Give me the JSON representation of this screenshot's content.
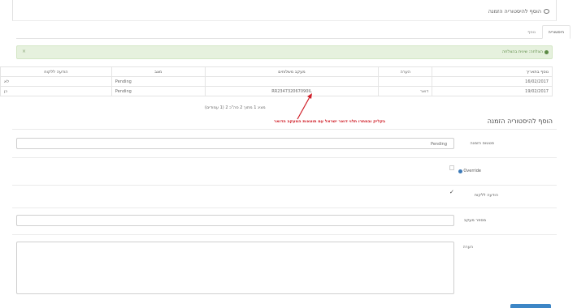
{
  "panel": {
    "title": "הוסף להיסטוריה הזמנה",
    "icon": "comment-icon"
  },
  "tabs": [
    {
      "label": "היסטוריה",
      "active": true
    },
    {
      "label": "נוסף",
      "active": false
    }
  ],
  "alert": {
    "text": "הצלחה: שינית בהצלחה",
    "close": "×",
    "color": "#e6f1de"
  },
  "history_table": {
    "headers": [
      "נוסף בתאריך",
      "הערה",
      "מעקב משלוחים",
      "מצב",
      "הודעה ללקוח"
    ],
    "rows": [
      {
        "date": "16/02/2017",
        "note": "",
        "tracking": "",
        "status": "Pending",
        "notify": "לא"
      },
      {
        "date": "19/02/2017",
        "note": "דואר",
        "tracking": "RR234732067090IL",
        "status": "Pending",
        "notify": "כן"
      }
    ]
  },
  "pagination": "מציג 1 מתוך 2 סה\"כ 2 (1 עמודים)",
  "annotation": "בקליק ובמתרו תלוי דואר ישראל עם תוצאות המעקב הדואר",
  "add_history": {
    "title": "הוסף להיסטוריה הזמנה",
    "order_status_label": "סטטוס הזמנה",
    "order_status_value": "Pending",
    "override_label": "Override",
    "notify_label": "הודעה ללקוח",
    "notify_checked": true,
    "tracking_label": "מספר מעקב",
    "comment_label": "הערה"
  },
  "colors": {
    "link": "#3d7ab8",
    "annotation": "#d0202a",
    "button": "#3d86c6"
  }
}
